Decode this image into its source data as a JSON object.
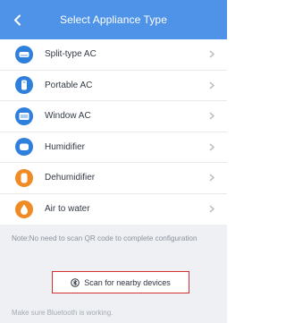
{
  "header": {
    "title": "Select Appliance Type",
    "back_icon": "chevron-left-icon"
  },
  "appliances": [
    {
      "label": "Split-type AC",
      "icon": "split-ac-icon",
      "color": "#2f7fdc"
    },
    {
      "label": "Portable AC",
      "icon": "portable-ac-icon",
      "color": "#2f7fdc"
    },
    {
      "label": "Window AC",
      "icon": "window-ac-icon",
      "color": "#2f7fdc"
    },
    {
      "label": "Humidifier",
      "icon": "humidifier-icon",
      "color": "#2f7fdc"
    },
    {
      "label": "Dehumidifier",
      "icon": "dehumidifier-icon",
      "color": "#f08a24"
    },
    {
      "label": "Air to water",
      "icon": "air-to-water-icon",
      "color": "#f08a24"
    }
  ],
  "note": "Note:No need to scan QR code to complete configuration",
  "scan_button": {
    "label": "Scan for nearby devices",
    "icon": "bluetooth-scan-icon",
    "highlight_color": "#d62f2f"
  },
  "footer": "Make sure Bluetooth is working.",
  "colors": {
    "header_bg": "#4f93e8",
    "page_bg": "#eef0f3"
  }
}
